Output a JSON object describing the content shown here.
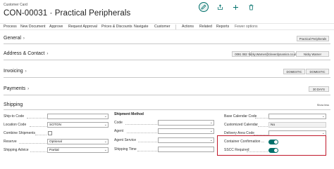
{
  "header": {
    "caption": "Customer Card",
    "title": "CON-00031 · Practical Peripherals",
    "icons": [
      "edit-icon",
      "share-icon",
      "add-icon",
      "delete-icon"
    ]
  },
  "actions": {
    "items": [
      "Process",
      "New Document",
      "Approve",
      "Request Approval",
      "Prices & Discounts",
      "Navigate",
      "Customer",
      "Actions",
      "Related",
      "Reports",
      "Fewer options"
    ]
  },
  "general": {
    "title": "General",
    "badge": "Practical Peripherals"
  },
  "address": {
    "title": "Address & Contact",
    "badges": [
      "0091 082",
      "Nicky.Warner@cleverdynamics.co.uk",
      "Nicky Warner"
    ]
  },
  "invoicing": {
    "title": "Invoicing",
    "badges": [
      "DOMESTIC",
      "DOMESTIC"
    ]
  },
  "payments": {
    "title": "Payments",
    "badge": "30 DAYS"
  },
  "shipping": {
    "title": "Shipping",
    "show_less": "Show less",
    "col1": [
      {
        "label": "Ship-to Code",
        "value": ""
      },
      {
        "label": "Location Code",
        "value": "SOTON"
      },
      {
        "label": "Combine Shipments",
        "value": ""
      },
      {
        "label": "Reserve",
        "value": "Optional"
      },
      {
        "label": "Shipping Advice",
        "value": "Partial"
      }
    ],
    "col2_heading": "Shipment Method",
    "col2": [
      {
        "label": "Code",
        "value": ""
      },
      {
        "label": "Agent",
        "value": ""
      },
      {
        "label": "Agent Service",
        "value": ""
      },
      {
        "label": "Shipping Time",
        "value": ""
      }
    ],
    "col3": [
      {
        "label": "Base Calendar Code",
        "value": ""
      },
      {
        "label": "Customized Calendar",
        "value": "No"
      },
      {
        "label": "Delivery Area Code",
        "value": ""
      },
      {
        "label": "Container Confirmation ...",
        "value": true
      },
      {
        "label": "SSCC Required",
        "value": true
      }
    ]
  },
  "colors": {
    "accent": "#00706b",
    "highlight": "#c0182a"
  }
}
